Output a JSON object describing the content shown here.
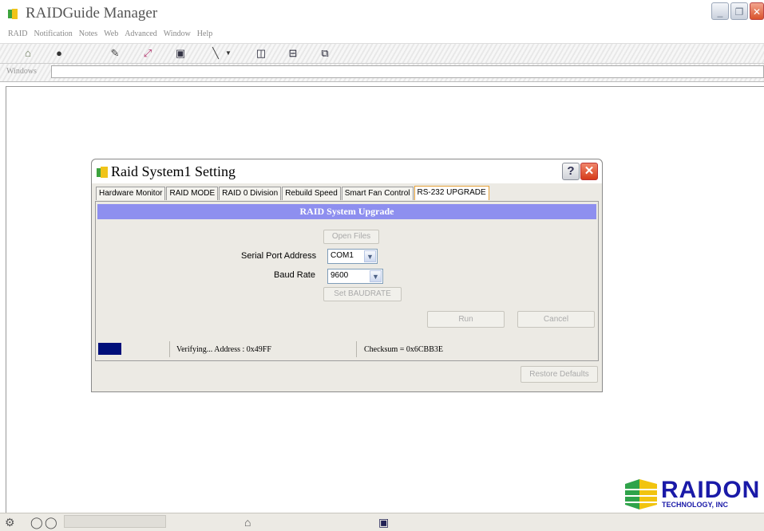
{
  "app": {
    "title": "RAIDGuide Manager",
    "window_buttons": {
      "minimize": "_",
      "restore": "❐",
      "close": "✕"
    }
  },
  "menu": [
    "RAID",
    "Notification",
    "Notes",
    "Web",
    "Advanced",
    "Window",
    "Help"
  ],
  "toolbar": {
    "icons": [
      "open-icon",
      "disc-icon",
      "edit-icon",
      "move-icon",
      "monitor-icon",
      "tools-icon",
      "dropdown-arrow-icon",
      "tile-vertical-icon",
      "tile-horizontal-icon",
      "cascade-icon"
    ]
  },
  "windows_bar": {
    "label": "Windows",
    "value": ""
  },
  "dialog": {
    "title": "Raid System1 Setting",
    "help_label": "?",
    "close_label": "✕",
    "tabs": [
      "Hardware Monitor",
      "RAID MODE",
      "RAID 0 Division",
      "Rebuild Speed",
      "Smart Fan Control",
      "RS-232 UPGRADE"
    ],
    "active_tab": "RS-232 UPGRADE",
    "panel_header": "RAID System Upgrade",
    "open_files_label": "Open Files",
    "serial_port_label": "Serial Port Address",
    "serial_port_value": "COM1",
    "baud_rate_label": "Baud Rate",
    "baud_rate_value": "9600",
    "set_baudrate_label": "Set BAUDRATE",
    "run_label": "Run",
    "cancel_label": "Cancel",
    "status_verifying": "Verifying... Address : 0x49FF",
    "status_checksum": "Checksum = 0x6CBB3E",
    "restore_defaults_label": "Restore Defaults",
    "colors": {
      "header": "#8e8fef",
      "progress": "#000f7a",
      "active_tab_border": "#e6a13a"
    }
  },
  "logo": {
    "name": "RAIDON",
    "sub": "TECHNOLOGY, INC"
  },
  "taskbar": {
    "icons": [
      "network-icon",
      "circle-icon",
      "circle-icon",
      "printer-icon",
      "computers-icon"
    ]
  }
}
